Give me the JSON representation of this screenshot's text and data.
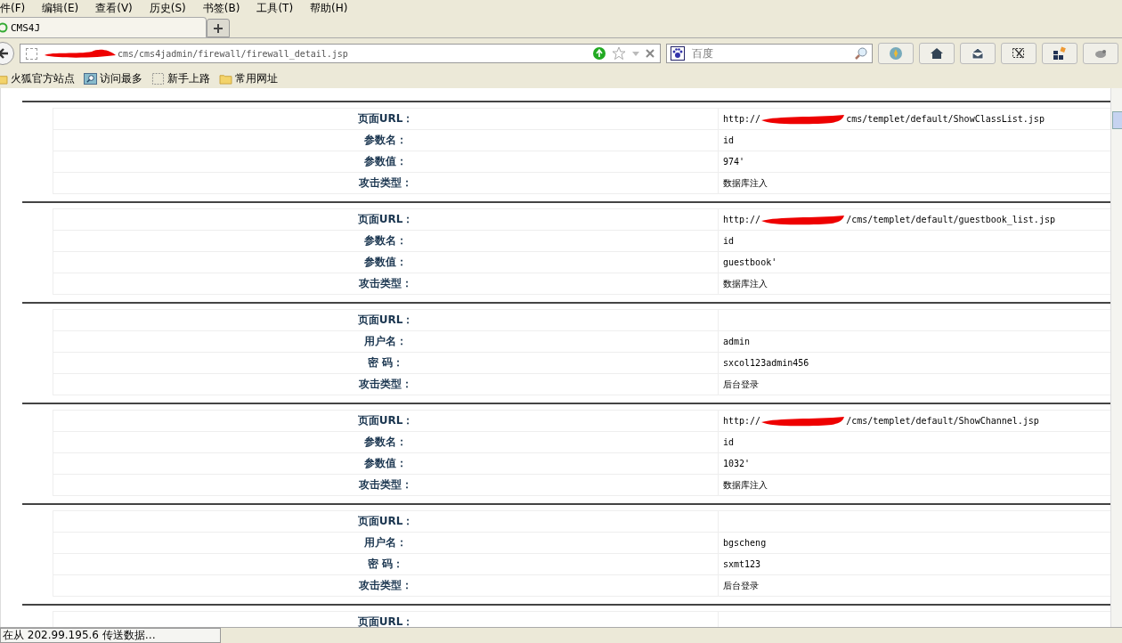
{
  "menu": [
    "件(F)",
    "编辑(E)",
    "查看(V)",
    "历史(S)",
    "书签(B)",
    "工具(T)",
    "帮助(H)"
  ],
  "tabs": [
    {
      "label": "CMS4J",
      "selected": true
    }
  ],
  "address": {
    "redacted": true,
    "value": "cms/cms4jadmin/firewall/firewall_detail.jsp"
  },
  "search": {
    "placeholder": "百度"
  },
  "bookmarks": [
    {
      "label": "火狐官方站点",
      "kind": "folder"
    },
    {
      "label": "访问最多",
      "kind": "search"
    },
    {
      "label": "新手上路",
      "kind": "blank"
    },
    {
      "label": "常用网址",
      "kind": "folder"
    }
  ],
  "records": [
    {
      "rows": [
        {
          "label": "页面URL：",
          "prefix": "http://",
          "redacted": true,
          "value": "cms/templet/default/ShowClassList.jsp"
        },
        {
          "label": "参数名：",
          "value": "id"
        },
        {
          "label": "参数值：",
          "value": "974'"
        },
        {
          "label": "攻击类型：",
          "value": "数据库注入"
        }
      ]
    },
    {
      "rows": [
        {
          "label": "页面URL：",
          "prefix": "http://",
          "redacted": true,
          "value": "/cms/templet/default/guestbook_list.jsp"
        },
        {
          "label": "参数名：",
          "value": "id"
        },
        {
          "label": "参数值：",
          "value": "guestbook'"
        },
        {
          "label": "攻击类型：",
          "value": "数据库注入"
        }
      ]
    },
    {
      "rows": [
        {
          "label": "页面URL："
        },
        {
          "label": "用户名：",
          "value": "admin"
        },
        {
          "label": "密  码：",
          "value": "sxcol123admin456"
        },
        {
          "label": "攻击类型：",
          "value": "后台登录"
        }
      ]
    },
    {
      "rows": [
        {
          "label": "页面URL：",
          "prefix": "http://",
          "redacted": true,
          "value": "/cms/templet/default/ShowChannel.jsp"
        },
        {
          "label": "参数名：",
          "value": "id"
        },
        {
          "label": "参数值：",
          "value": "1032'"
        },
        {
          "label": "攻击类型：",
          "value": "数据库注入"
        }
      ]
    },
    {
      "rows": [
        {
          "label": "页面URL："
        },
        {
          "label": "用户名：",
          "value": "bgscheng"
        },
        {
          "label": "密  码：",
          "value": "sxmt123"
        },
        {
          "label": "攻击类型：",
          "value": "后台登录"
        }
      ]
    },
    {
      "rows": [
        {
          "label": "页面URL："
        }
      ]
    }
  ],
  "status_bar": "在从 202.99.195.6 传送数据…"
}
